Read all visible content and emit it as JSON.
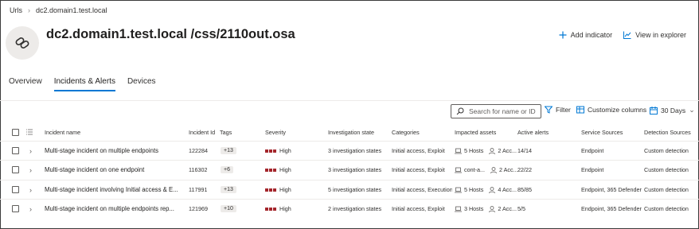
{
  "breadcrumb": {
    "root": "Urls",
    "current": "dc2.domain1.test.local"
  },
  "page": {
    "title": "dc2.domain1.test.local /css/2110out.osa"
  },
  "actions": {
    "add_indicator": "Add indicator",
    "view_in_explorer": "View in explorer"
  },
  "tabs": [
    {
      "label": "Overview",
      "active": false
    },
    {
      "label": "Incidents & Alerts",
      "active": true
    },
    {
      "label": "Devices",
      "active": false
    }
  ],
  "toolbar": {
    "search_placeholder": "Search for name or ID",
    "filter": "Filter",
    "customize_columns": "Customize columns",
    "time_range": "30 Days"
  },
  "table": {
    "columns": [
      "Incident name",
      "Incident Id",
      "Tags",
      "Severity",
      "Investigation state",
      "Categories",
      "Impacted assets",
      "Active alerts",
      "Service Sources",
      "Detection Sources"
    ],
    "rows": [
      {
        "name": "Multi-stage incident on multiple endpoints",
        "id": "122284",
        "tag": "+13",
        "severity": "High",
        "investigation": "3 investigation states",
        "categories": "Initial access, Exploit",
        "hosts": "5 Hosts",
        "users": "2 Acc...",
        "alerts": "14/14",
        "service": "Endpoint",
        "detection": "Custom detection"
      },
      {
        "name": "Multi-stage incident on one endpoint",
        "id": "116302",
        "tag": "+6",
        "severity": "High",
        "investigation": "3 investigation states",
        "categories": "Initial access, Exploit",
        "hosts": "cont-a...",
        "users": "2 Acc...",
        "alerts": "22/22",
        "service": "Endpoint",
        "detection": "Custom detection"
      },
      {
        "name": "Multi-stage incident involving Initial access & E...",
        "id": "117991",
        "tag": "+13",
        "severity": "High",
        "investigation": "5 investigation states",
        "categories": "Initial access, Execution...",
        "hosts": "5 Hosts",
        "users": "4 Acc...",
        "alerts": "85/85",
        "service": "Endpoint, 365 Defender",
        "detection": "Custom detection"
      },
      {
        "name": "Multi-stage incident on multiple endpoints rep...",
        "id": "121969",
        "tag": "+10",
        "severity": "High",
        "investigation": "2 investigation states",
        "categories": "Initial access, Exploit",
        "hosts": "3 Hosts",
        "users": "2 Acc...",
        "alerts": "5/5",
        "service": "Endpoint, 365 Defender",
        "detection": "Custom detection"
      }
    ]
  },
  "icons": {
    "entity": "link-icon",
    "add": "plus-icon",
    "explorer": "chart-icon",
    "search": "search-icon",
    "filter": "filter-icon",
    "columns": "columns-icon",
    "calendar": "calendar-icon",
    "host": "laptop-icon",
    "user": "user-icon"
  },
  "colors": {
    "accent": "#0078d4",
    "severity_high": "#a4262c"
  }
}
